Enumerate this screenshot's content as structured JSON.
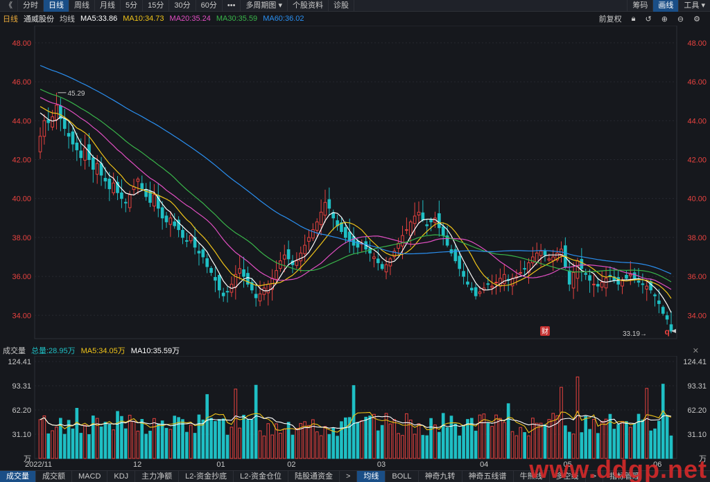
{
  "toolbar": {
    "left": [
      "《",
      "分时",
      "日线",
      "周线",
      "月线",
      "5分",
      "15分",
      "30分",
      "60分",
      "•••",
      "多周期图 ▾",
      "个股资料",
      "诊股"
    ],
    "active_index": 2,
    "right": [
      "筹码",
      "画线",
      "工具 ▾"
    ],
    "right_active_index": 1
  },
  "legend": {
    "period": "日线",
    "stock": "通威股份",
    "avg": "均线",
    "ma5": "MA5:33.86",
    "ma10": "MA10:34.73",
    "ma20": "MA20:35.24",
    "ma30": "MA30:35.59",
    "ma60": "MA60:36.02",
    "fuquan": "前复权"
  },
  "colors": {
    "up": "#e8423f",
    "down": "#1fbfc4",
    "ma5": "#ffffff",
    "ma10": "#f0c419",
    "ma20": "#e24fc3",
    "ma30": "#39b54a",
    "ma60": "#2a8ff0",
    "axis": "#e8423f"
  },
  "price_axis": [
    "48.00",
    "46.00",
    "44.00",
    "42.00",
    "40.00",
    "38.00",
    "36.00",
    "34.00"
  ],
  "annotations": {
    "high": "45.29",
    "low": "33.19",
    "cai_badge": "财",
    "q_badge": "q"
  },
  "volume_legend": {
    "title": "成交量",
    "total": "总量:28.95万",
    "ma5": "MA5:34.05万",
    "ma10": "MA10:35.59万"
  },
  "volume_axis": [
    "124.41",
    "93.31",
    "62.20",
    "31.10",
    "万"
  ],
  "x_axis": [
    "2022/11",
    "12",
    "01",
    "02",
    "03",
    "04",
    "05",
    "06"
  ],
  "bottom_tabs": [
    "成交量",
    "成交额",
    "MACD",
    "KDJ",
    "主力净额",
    "L2-资金抄底",
    "L2-资金仓位",
    "陆股通资金",
    ">",
    "均线",
    "BOLL",
    "神奇九转",
    "神奇五线谱",
    "牛熊线",
    "多空线",
    ">",
    "指标管理"
  ],
  "watermark": "www.ddgp.net",
  "chart_data": {
    "type": "candlestick",
    "title": "通威股份 日线",
    "ylim": [
      32.8,
      48.6
    ],
    "closes": [
      43.2,
      44.0,
      43.9,
      44.2,
      44.8,
      44.1,
      43.6,
      43.2,
      42.8,
      42.5,
      42.1,
      42.6,
      42.0,
      41.5,
      41.8,
      41.2,
      40.9,
      40.5,
      40.8,
      40.3,
      40.0,
      39.8,
      40.2,
      40.6,
      41.0,
      40.5,
      40.1,
      39.8,
      40.2,
      39.5,
      39.0,
      38.8,
      39.0,
      38.6,
      38.4,
      38.0,
      37.8,
      38.1,
      37.5,
      37.2,
      37.0,
      36.5,
      36.2,
      35.8,
      35.3,
      35.0,
      35.2,
      35.6,
      36.1,
      36.4,
      36.0,
      35.6,
      35.3,
      34.9,
      35.1,
      35.4,
      35.6,
      35.9,
      36.3,
      36.8,
      37.1,
      36.9,
      36.6,
      36.8,
      37.2,
      37.6,
      38.0,
      38.4,
      38.8,
      39.3,
      39.8,
      39.5,
      39.0,
      38.6,
      38.3,
      38.0,
      37.8,
      37.6,
      37.5,
      37.7,
      37.4,
      37.2,
      37.0,
      36.7,
      36.4,
      36.6,
      36.9,
      37.3,
      37.7,
      38.1,
      38.4,
      38.8,
      39.1,
      39.3,
      38.9,
      38.6,
      38.8,
      39.0,
      38.5,
      38.1,
      37.6,
      37.2,
      36.8,
      36.4,
      36.0,
      35.6,
      35.3,
      35.0,
      35.2,
      35.4,
      35.6,
      35.5,
      35.7,
      35.9,
      36.1,
      35.8,
      35.9,
      36.0,
      36.2,
      36.4,
      36.7,
      37.0,
      37.2,
      37.3,
      37.1,
      36.9,
      37.0,
      37.2,
      37.4,
      36.5,
      35.6,
      36.2,
      36.8,
      36.4,
      36.1,
      35.8,
      35.6,
      35.5,
      35.7,
      35.9,
      36.0,
      35.8,
      35.6,
      35.8,
      35.9,
      36.1,
      35.9,
      35.7,
      35.6,
      35.5,
      35.3,
      35.0,
      34.6,
      34.1,
      33.8,
      33.19
    ],
    "ma5_last": 33.86,
    "ma10_last": 34.73,
    "ma20_last": 35.24,
    "ma30_last": 35.59,
    "ma60_last": 36.02,
    "volume_ylim": [
      0,
      124.41
    ],
    "volume_unit": "万"
  }
}
